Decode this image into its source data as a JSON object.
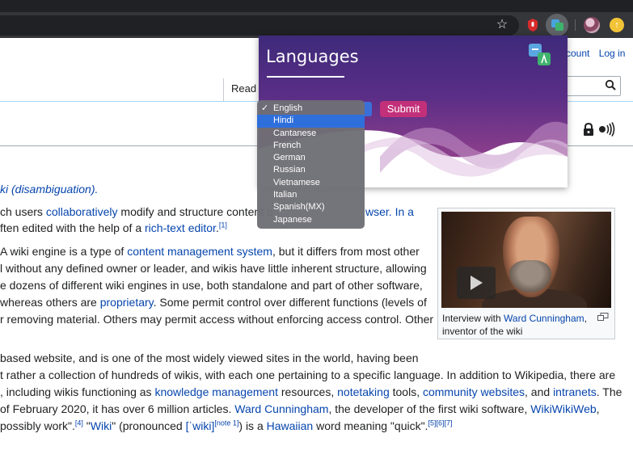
{
  "browser": {
    "icons": [
      "star-icon",
      "ext-red-hand-icon",
      "ext-translate-icon",
      "profile-avatar",
      "update-icon"
    ]
  },
  "wiki": {
    "account": {
      "create": "count",
      "login": "Log in"
    },
    "tabs": {
      "read": "Read"
    },
    "disambiguation": "ki (disambiguation).",
    "para1": {
      "l1_a": "ch users ",
      "l1_link": "collaboratively",
      "l1_b": " modify and structure content o",
      "l1_c": "wser. In a",
      "l2_a": "ften edited with the help of a ",
      "l2_link": "rich-text editor",
      "l2_b": ".",
      "l2_ref": "[1]"
    },
    "para2": {
      "l1_a": " A wiki engine is a type of ",
      "l1_link": "content management system",
      "l1_b": ", but it differs from most other",
      "l2": "l without any defined owner or leader, and wikis have little inherent structure, allowing",
      "l3": "e dozens of different wiki engines in use, both standalone and part of other software,",
      "l4_a": " whereas others are ",
      "l4_link": "proprietary",
      "l4_b": ". Some permit control over different functions (levels of",
      "l5": "r removing material. Others may permit access without enforcing access control. Other"
    },
    "para3": {
      "l1": "based website, and is one of the most widely viewed sites in the world, having been",
      "l2_a": "t rather a collection of hundreds of wikis, with each one pertaining to a specific language. In addition to Wikipedia, there are",
      "l3_a": ", including wikis functioning as ",
      "l3_link1": "knowledge management",
      "l3_b": " resources, ",
      "l3_link2": "notetaking",
      "l3_c": " tools, ",
      "l3_link3": "community websites",
      "l3_d": ", and ",
      "l3_link4": "intranets",
      "l3_e": ". The",
      "l4_a": " of February 2020, it has over 6 million articles. ",
      "l4_link1": "Ward Cunningham",
      "l4_b": ", the developer of the first wiki software, ",
      "l4_link2": "WikiWikiWeb",
      "l4_c": ",",
      "l5_a": " possibly work\".",
      "l5_ref1": "[4]",
      "l5_b": " \"",
      "l5_link1": "Wiki",
      "l5_c": "\" (pronounced ",
      "l5_link2": "[ˈwiki]",
      "l5_ref2": "[note 1]",
      "l5_d": ") is a ",
      "l5_link3": "Hawaiian",
      "l5_e": " word meaning \"quick\".",
      "l5_ref3": "[5][6][7]"
    },
    "thumb": {
      "caption_a": "Interview with ",
      "caption_link": "Ward Cunningham",
      "caption_b": ",",
      "caption_c": "inventor of the wiki"
    }
  },
  "popup": {
    "title": "Languages",
    "submit_label": "Submit",
    "selected_language": "English",
    "highlighted_language": "Hindi",
    "languages": [
      "English",
      "Hindi",
      "Cantanese",
      "French",
      "German",
      "Russian",
      "Vietnamese",
      "Italian",
      "Spanish(MX)",
      "Japanese"
    ],
    "colors": {
      "submit": "#c2307a",
      "highlight": "#2f6fdc",
      "gradient_top": "#4b2a86",
      "gradient_bottom": "#b03a7e"
    }
  }
}
